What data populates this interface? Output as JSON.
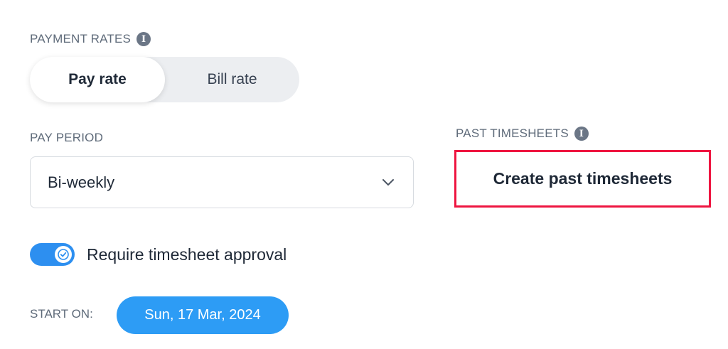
{
  "payment_rates": {
    "label": "PAYMENT RATES",
    "info_icon": "info-icon",
    "options": [
      {
        "label": "Pay rate",
        "selected": true
      },
      {
        "label": "Bill rate",
        "selected": false
      }
    ]
  },
  "pay_period": {
    "label": "PAY PERIOD",
    "value": "Bi-weekly",
    "icon": "chevron-down-icon"
  },
  "past_timesheets": {
    "label": "PAST TIMESHEETS",
    "info_icon": "info-icon",
    "button_label": "Create past timesheets"
  },
  "approval": {
    "label": "Require timesheet approval",
    "enabled": true
  },
  "start": {
    "label": "START ON:",
    "date": "Sun, 17 Mar, 2024"
  },
  "colors": {
    "accent": "#2d8ff0",
    "date_pill": "#2d9cf5",
    "highlight_border": "#ee1540",
    "label_text": "#5f6b7a"
  }
}
